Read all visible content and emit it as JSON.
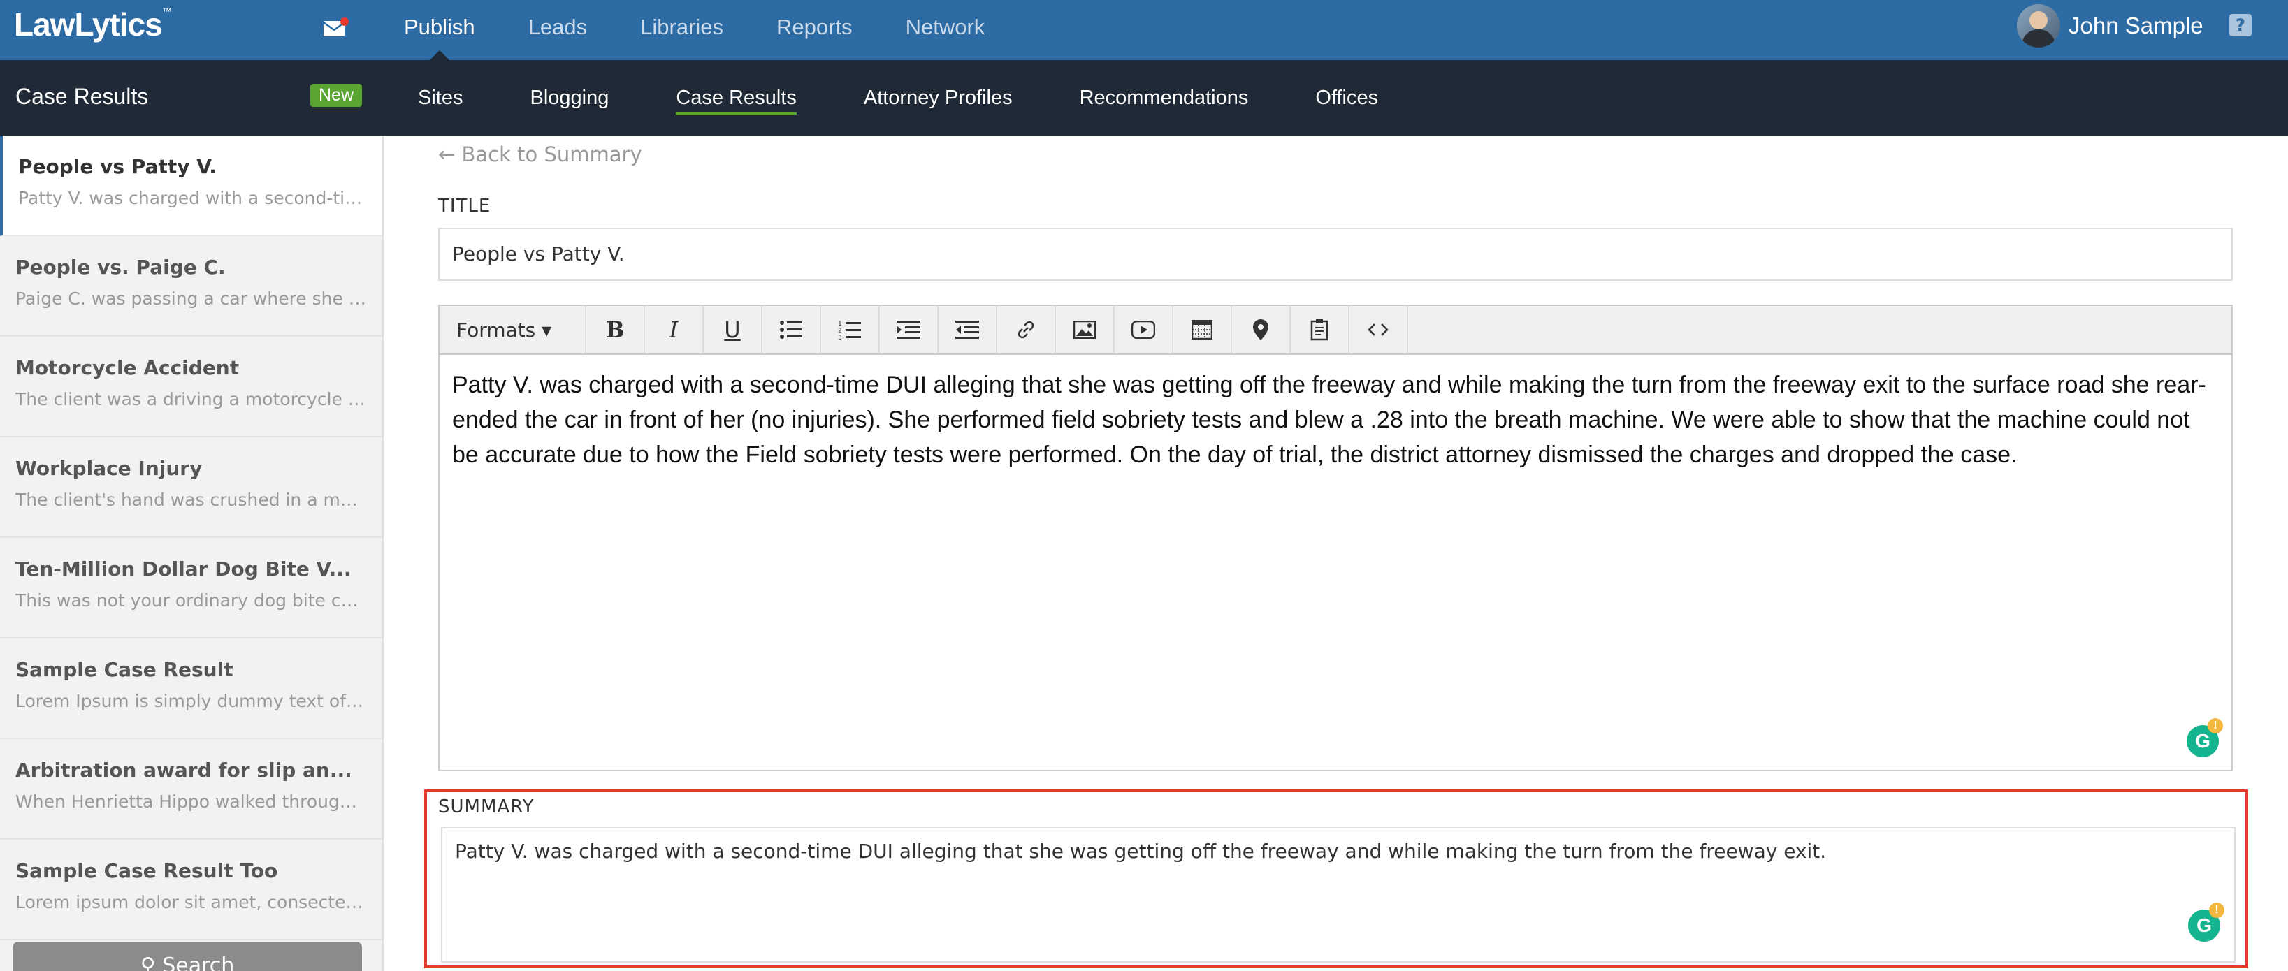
{
  "topbar": {
    "logo": "LawLytics",
    "logo_mark": "™",
    "nav": [
      "Publish",
      "Leads",
      "Libraries",
      "Reports",
      "Network"
    ],
    "active": "Publish",
    "user_name": "John Sample",
    "help": "?"
  },
  "subbar": {
    "title": "Case Results",
    "badge": "New",
    "nav": [
      "Sites",
      "Blogging",
      "Case Results",
      "Attorney Profiles",
      "Recommendations",
      "Offices"
    ],
    "active": "Case Results"
  },
  "sidebar": {
    "items": [
      {
        "title": "People vs Patty V.",
        "snippet": "Patty V. was charged with a second-time..."
      },
      {
        "title": "People vs. Paige C.",
        "snippet": "Paige C. was passing a car where she hit ..."
      },
      {
        "title": "Motorcycle Accident",
        "snippet": "The client was a driving a motorcycle on ..."
      },
      {
        "title": "Workplace Injury",
        "snippet": "The client's hand was crushed in a machi..."
      },
      {
        "title": "Ten-Million Dollar Dog Bite V...",
        "snippet": "This was not your ordinary dog bite case...."
      },
      {
        "title": "Sample Case Result",
        "snippet": "Lorem Ipsum is simply dummy text of th..."
      },
      {
        "title": "Arbitration award for slip an...",
        "snippet": "When Henrietta Hippo walked through th..."
      },
      {
        "title": "Sample Case Result Too",
        "snippet": "Lorem ipsum dolor sit amet, consectetur ..."
      }
    ],
    "search_label": "Search"
  },
  "main": {
    "back_link": "← Back to Summary",
    "title_label": "TITLE",
    "title_value": "People vs Patty V.",
    "toolbar_formats": "Formats",
    "body_text": "Patty V. was charged with a second-time DUI alleging that she was getting off the freeway and while making the turn from the freeway exit to the surface road she rear-ended the car in front of her (no injuries). She performed field sobriety tests and blew a .28 into the breath machine.  We were able to show that the machine could not be accurate due to how the Field sobriety tests were performed. On the day of trial, the district attorney dismissed the charges and dropped the case.",
    "summary_label": "SUMMARY",
    "summary_value": "Patty V. was charged with a second-time DUI alleging that she was getting off the freeway and while making the turn from the freeway exit.",
    "grammarly_letter": "G"
  },
  "colors": {
    "topbar": "#2c6ba3",
    "subbar": "#1f2a36",
    "accent_green": "#5aa531",
    "highlight_red": "#e63a2c"
  }
}
